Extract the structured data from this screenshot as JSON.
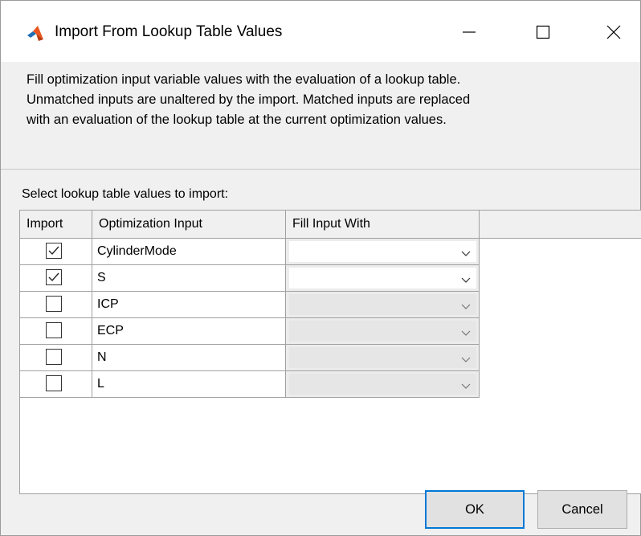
{
  "window": {
    "title": "Import From Lookup Table Values",
    "icon": "matlab-logo-icon",
    "controls": [
      "minimize-icon",
      "maximize-icon",
      "close-icon"
    ]
  },
  "description": {
    "line1": "Fill optimization input variable values with the evaluation of a lookup table.",
    "line2": "Unmatched inputs are unaltered by the import. Matched inputs are replaced",
    "line3": "with an evaluation of the lookup table at the current optimization values."
  },
  "table": {
    "label": "Select lookup table values to import:",
    "headers": {
      "import": "Import",
      "input": "Optimization Input",
      "fill": "Fill Input With"
    },
    "rows": [
      {
        "checked": true,
        "name": "CylinderMode",
        "fill_value": "",
        "enabled": true
      },
      {
        "checked": true,
        "name": "S",
        "fill_value": "",
        "enabled": true
      },
      {
        "checked": false,
        "name": "ICP",
        "fill_value": "",
        "enabled": false
      },
      {
        "checked": false,
        "name": "ECP",
        "fill_value": "",
        "enabled": false
      },
      {
        "checked": false,
        "name": "N",
        "fill_value": "",
        "enabled": false
      },
      {
        "checked": false,
        "name": "L",
        "fill_value": "",
        "enabled": false
      }
    ]
  },
  "buttons": {
    "ok": "OK",
    "cancel": "Cancel"
  },
  "colors": {
    "accent": "#0078d7",
    "dialog_bg": "#f0f0f0"
  }
}
